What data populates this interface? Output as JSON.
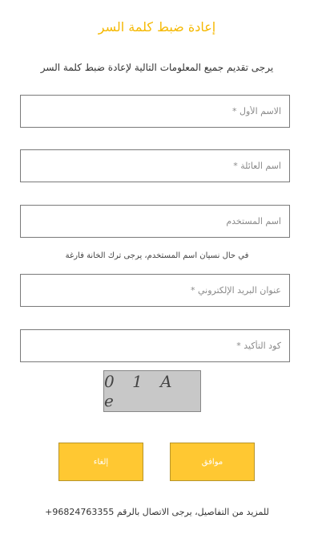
{
  "header": {
    "title": "إعادة ضبط كلمة السر",
    "subtitle": "يرجى تقديم جميع المعلومات التالية لإعادة ضبط كلمة السر"
  },
  "form": {
    "first_name_placeholder": "الاسم الأول *",
    "family_name_placeholder": "اسم العائلة *",
    "username_placeholder": "اسم المستخدم",
    "username_hint": "في حال نسيان اسم المستخدم، يرجى ترك الخانة فارغة",
    "email_placeholder": "عنوان البريد الإلكتروني *",
    "confirm_code_placeholder": "كود التأكيد *"
  },
  "captcha": {
    "code": "0 1 A e"
  },
  "buttons": {
    "ok_label": "موافق",
    "cancel_label": "إلغاء"
  },
  "footer": {
    "contact_text": "للمزيد من التفاصيل، يرجى الاتصال بالرقم 96824763355+"
  },
  "colors": {
    "accent": "#f5b800",
    "button_fill": "#ffc832",
    "captcha_bg": "#c8c8c8"
  }
}
